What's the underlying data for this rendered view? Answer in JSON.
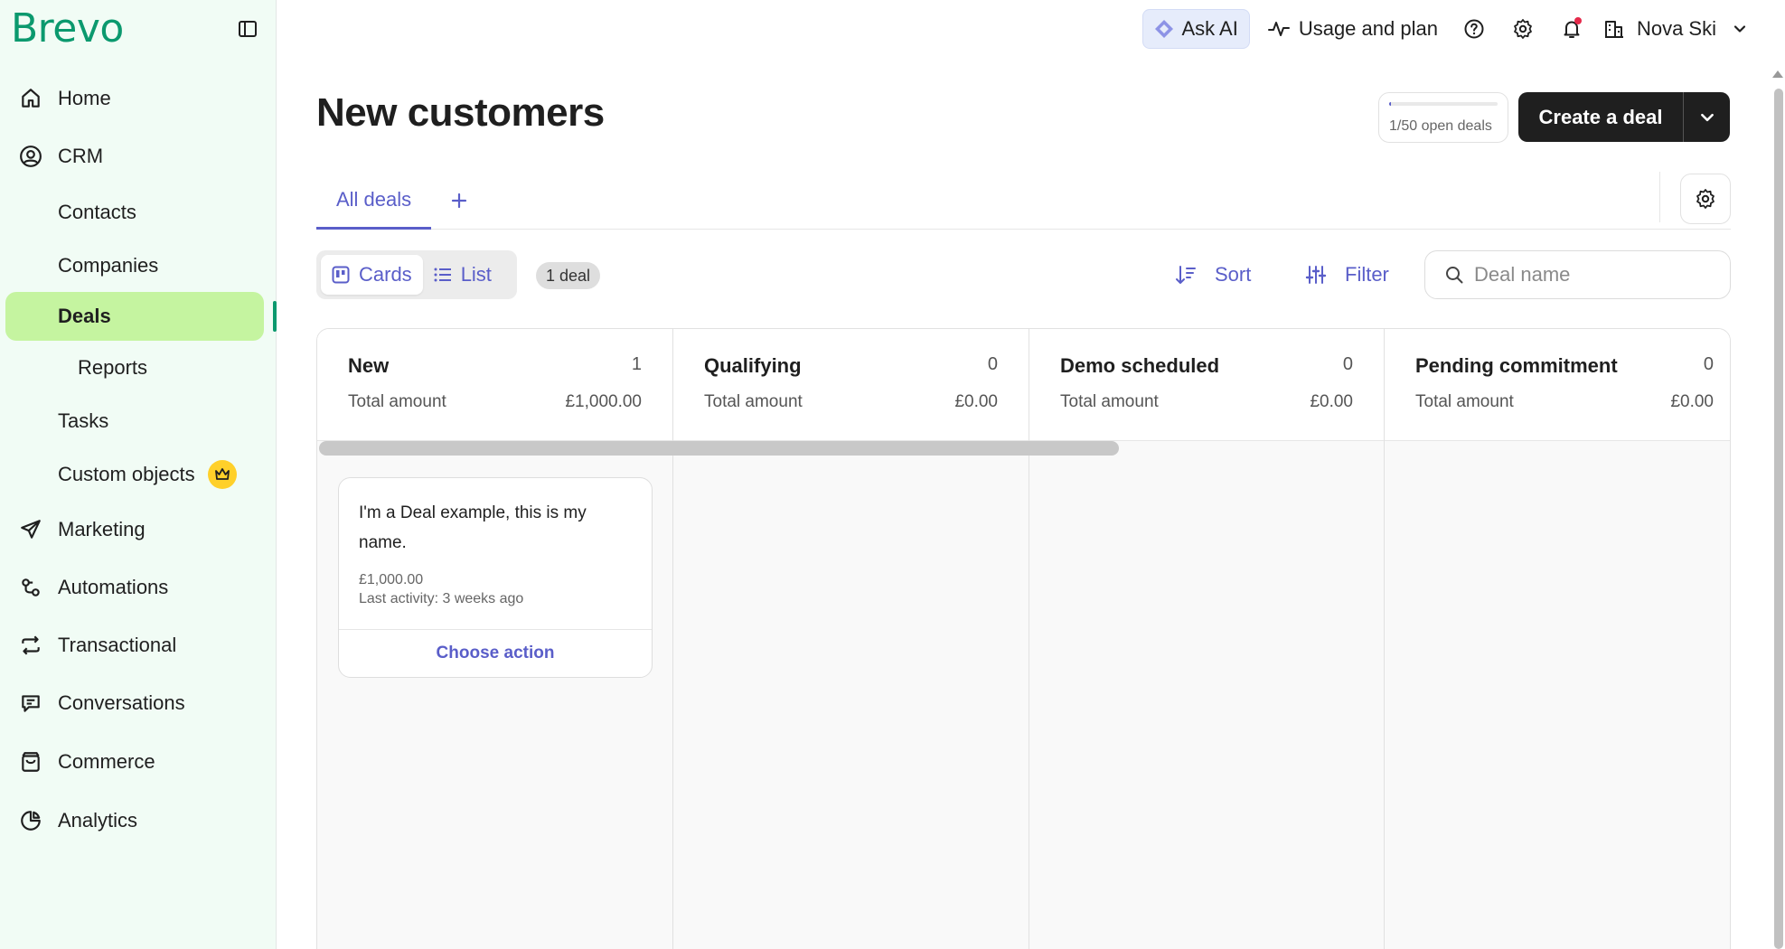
{
  "brand": {
    "logo_text": "Brevo",
    "accent": "#0b996e",
    "link_color": "#5a5ec9"
  },
  "sidebar": {
    "items": [
      {
        "label": "Home",
        "icon": "home-icon"
      },
      {
        "label": "CRM",
        "icon": "user-circle-icon"
      },
      {
        "label": "Contacts"
      },
      {
        "label": "Companies"
      },
      {
        "label": "Deals",
        "active": true
      },
      {
        "label": "Reports"
      },
      {
        "label": "Tasks"
      },
      {
        "label": "Custom objects",
        "badge_icon": "crown-icon"
      },
      {
        "label": "Marketing",
        "icon": "send-icon"
      },
      {
        "label": "Automations",
        "icon": "automation-icon"
      },
      {
        "label": "Transactional",
        "icon": "repeat-icon"
      },
      {
        "label": "Conversations",
        "icon": "chat-icon"
      },
      {
        "label": "Commerce",
        "icon": "bag-icon"
      },
      {
        "label": "Analytics",
        "icon": "pie-chart-icon"
      }
    ]
  },
  "topbar": {
    "ask_ai": "Ask AI",
    "usage": "Usage and plan",
    "account_name": "Nova Ski"
  },
  "page": {
    "title": "New customers",
    "open_deals_label": "1/50 open deals",
    "open_deals_fraction": 0.02,
    "create_button": "Create a deal"
  },
  "tabs": [
    {
      "label": "All deals",
      "active": true
    }
  ],
  "toolbar": {
    "view_cards": "Cards",
    "view_list": "List",
    "deal_count": "1 deal",
    "sort": "Sort",
    "filter": "Filter",
    "search_placeholder": "Deal name"
  },
  "pipeline": {
    "total_label": "Total amount",
    "stages": [
      {
        "name": "New",
        "count": "1",
        "total": "£1,000.00"
      },
      {
        "name": "Qualifying",
        "count": "0",
        "total": "£0.00"
      },
      {
        "name": "Demo scheduled",
        "count": "0",
        "total": "£0.00"
      },
      {
        "name": "Pending commitment",
        "count": "0",
        "total": "£0.00"
      }
    ]
  },
  "deal_card": {
    "name": "I'm a Deal example, this is my name.",
    "amount": "£1,000.00",
    "last_activity": "Last activity: 3 weeks ago",
    "action": "Choose action"
  }
}
